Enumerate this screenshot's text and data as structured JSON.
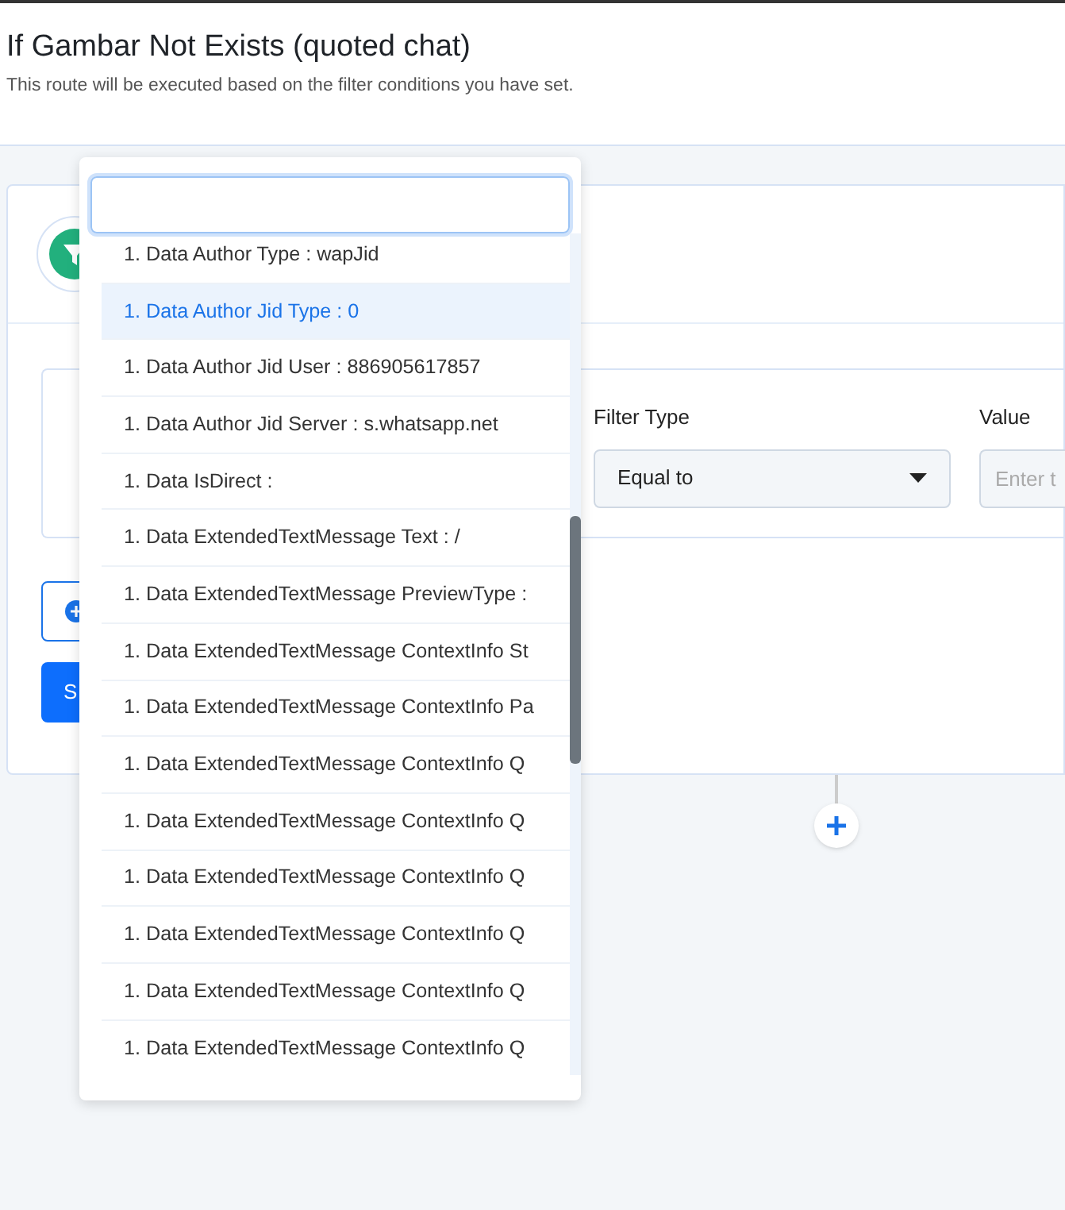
{
  "header": {
    "title": "If Gambar Not Exists (quoted chat)",
    "subtitle": "This route will be executed based on the filter conditions you have set."
  },
  "condition": {
    "filter_type_label": "Filter Type",
    "filter_type_value": "Equal to",
    "value_label": "Value",
    "value_placeholder": "Enter t"
  },
  "buttons": [
    {
      "kind": "outline"
    },
    {
      "kind": "primary",
      "label": "S"
    }
  ],
  "dropdown": {
    "items": [
      {
        "label": "1. Data Author Type : wapJid",
        "selected": false
      },
      {
        "label": "1. Data Author Jid Type : 0",
        "selected": true
      },
      {
        "label": "1. Data Author Jid User : 886905617857",
        "selected": false
      },
      {
        "label": "1. Data Author Jid Server : s.whatsapp.net",
        "selected": false
      },
      {
        "label": "1. Data IsDirect :",
        "selected": false
      },
      {
        "label": "1. Data ExtendedTextMessage Text : /",
        "selected": false
      },
      {
        "label": "1. Data ExtendedTextMessage PreviewType :",
        "selected": false
      },
      {
        "label": "1. Data ExtendedTextMessage ContextInfo St",
        "selected": false
      },
      {
        "label": "1. Data ExtendedTextMessage ContextInfo Pa",
        "selected": false
      },
      {
        "label": "1. Data ExtendedTextMessage ContextInfo Q",
        "selected": false
      },
      {
        "label": "1. Data ExtendedTextMessage ContextInfo Q",
        "selected": false
      },
      {
        "label": "1. Data ExtendedTextMessage ContextInfo Q",
        "selected": false
      },
      {
        "label": "1. Data ExtendedTextMessage ContextInfo Q",
        "selected": false
      },
      {
        "label": "1. Data ExtendedTextMessage ContextInfo Q",
        "selected": false
      },
      {
        "label": "1. Data ExtendedTextMessage ContextInfo Q",
        "selected": false
      }
    ]
  }
}
